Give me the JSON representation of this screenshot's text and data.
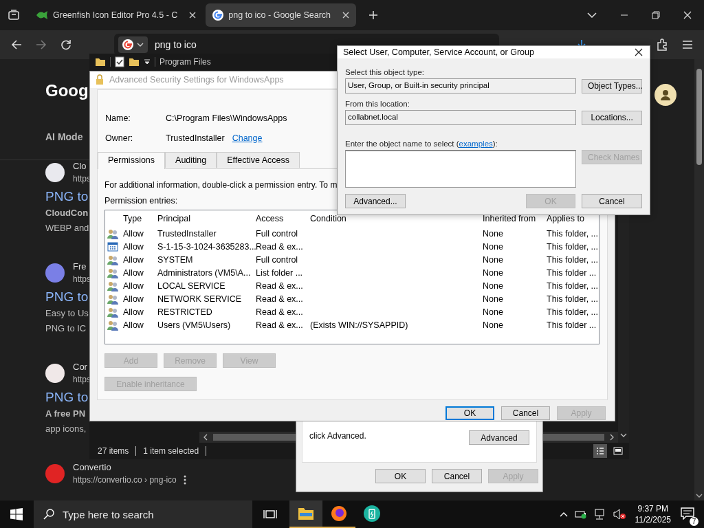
{
  "browser": {
    "tabs": [
      {
        "kind": "fish",
        "title": "Greenfish Icon Editor Pro 4.5 - C",
        "selected": false
      },
      {
        "kind": "google",
        "title": "png to ico - Google Search",
        "selected": true
      }
    ],
    "address": "png to ico",
    "logo": "Goog",
    "ai_mode": "AI Mode",
    "results": [
      {
        "color": "#e9e9ee",
        "site": "Clo",
        "url": "https",
        "title": "PNG to",
        "snippet": [
          "**CloudCon**",
          "WEBP and"
        ]
      },
      {
        "color": "#7a7fe6",
        "site": "Fre",
        "url": "https",
        "title": "PNG to",
        "snippet": [
          "Easy to Us",
          "PNG to IC"
        ]
      },
      {
        "color": "#f0e8e8",
        "site": "Cor",
        "url": "https",
        "title": "PNG to",
        "snippet": [
          "**A free PN**",
          "app icons,"
        ]
      },
      {
        "color": "#e02424",
        "site": "Convertio",
        "url": "https://convertio.co › png-ico"
      }
    ]
  },
  "explorer": {
    "title": "Program Files",
    "status": [
      "27 items",
      "1 item selected"
    ]
  },
  "security": {
    "title": "Advanced Security Settings for WindowsApps",
    "name_label": "Name:",
    "name": "C:\\Program Files\\WindowsApps",
    "owner_label": "Owner:",
    "owner": "TrustedInstaller",
    "change": "Change",
    "tabs": [
      {
        "label": "Permissions",
        "selected": true
      },
      {
        "label": "Auditing",
        "selected": false
      },
      {
        "label": "Effective Access",
        "selected": false
      }
    ],
    "info": "For additional information, double-click a permission entry. To m",
    "entries_label": "Permission entries:",
    "columns": [
      "Type",
      "Principal",
      "Access",
      "Condition",
      "Inherited from",
      "Applies to"
    ],
    "rows": [
      {
        "kind": "group",
        "type": "Allow",
        "principal": "TrustedInstaller",
        "access": "Full control",
        "inherited": "None",
        "applies": "This folder, ..."
      },
      {
        "kind": "package",
        "type": "Allow",
        "principal": "S-1-15-3-1024-3635283...",
        "access": "Read & ex...",
        "inherited": "None",
        "applies": "This folder, ..."
      },
      {
        "kind": "group",
        "type": "Allow",
        "principal": "SYSTEM",
        "access": "Full control",
        "inherited": "None",
        "applies": "This folder, ..."
      },
      {
        "kind": "group",
        "type": "Allow",
        "principal": "Administrators (VM5\\A...",
        "access": "List folder ...",
        "inherited": "None",
        "applies": "This folder ..."
      },
      {
        "kind": "group",
        "type": "Allow",
        "principal": "LOCAL SERVICE",
        "access": "Read & ex...",
        "inherited": "None",
        "applies": "This folder, ..."
      },
      {
        "kind": "group",
        "type": "Allow",
        "principal": "NETWORK SERVICE",
        "access": "Read & ex...",
        "inherited": "None",
        "applies": "This folder, ..."
      },
      {
        "kind": "group",
        "type": "Allow",
        "principal": "RESTRICTED",
        "access": "Read & ex...",
        "inherited": "None",
        "applies": "This folder, ..."
      },
      {
        "kind": "group",
        "type": "Allow",
        "principal": "Users (VM5\\Users)",
        "access": "Read & ex...",
        "condition": "(Exists WIN://SYSAPPID)",
        "inherited": "None",
        "applies": "This folder ..."
      }
    ],
    "entry_buttons": [
      {
        "label": "Add",
        "disabled": true
      },
      {
        "label": "Remove",
        "disabled": true
      },
      {
        "label": "View",
        "disabled": true
      }
    ],
    "inheritance": {
      "label": "Enable inheritance",
      "disabled": true
    },
    "footer": [
      {
        "label": "OK",
        "default": true,
        "disabled": false
      },
      {
        "label": "Cancel",
        "default": false,
        "disabled": false
      },
      {
        "label": "Apply",
        "default": false,
        "disabled": true
      }
    ]
  },
  "properties": {
    "text": "click Advanced.",
    "advanced": "Advanced",
    "footer": [
      {
        "label": "OK",
        "disabled": false
      },
      {
        "label": "Cancel",
        "disabled": false
      },
      {
        "label": "Apply",
        "disabled": true
      }
    ]
  },
  "select": {
    "title": "Select User, Computer, Service Account, or Group",
    "type_label": "Select this object type:",
    "type_value": "User, Group, or Built-in security principal",
    "object_types": "Object Types...",
    "location_label": "From this location:",
    "location": "collabnet.local",
    "locations": "Locations...",
    "name_label_before": "Enter the object name to select (",
    "examples": "examples",
    "name_label_after": "):",
    "check_names": {
      "label": "Check Names",
      "disabled": true
    },
    "advanced": "Advanced...",
    "ok": {
      "label": "OK",
      "disabled": true
    },
    "cancel": {
      "label": "Cancel",
      "disabled": false
    }
  },
  "taskbar": {
    "search_placeholder": "Type here to search",
    "apps": [
      {
        "kind": "explorer",
        "running": true,
        "active": true
      },
      {
        "kind": "firefox",
        "running": true,
        "active": false
      },
      {
        "kind": "battery",
        "running": false,
        "active": false
      }
    ],
    "time": "9:37 PM",
    "date": "11/2/2025",
    "notifications": "7"
  }
}
